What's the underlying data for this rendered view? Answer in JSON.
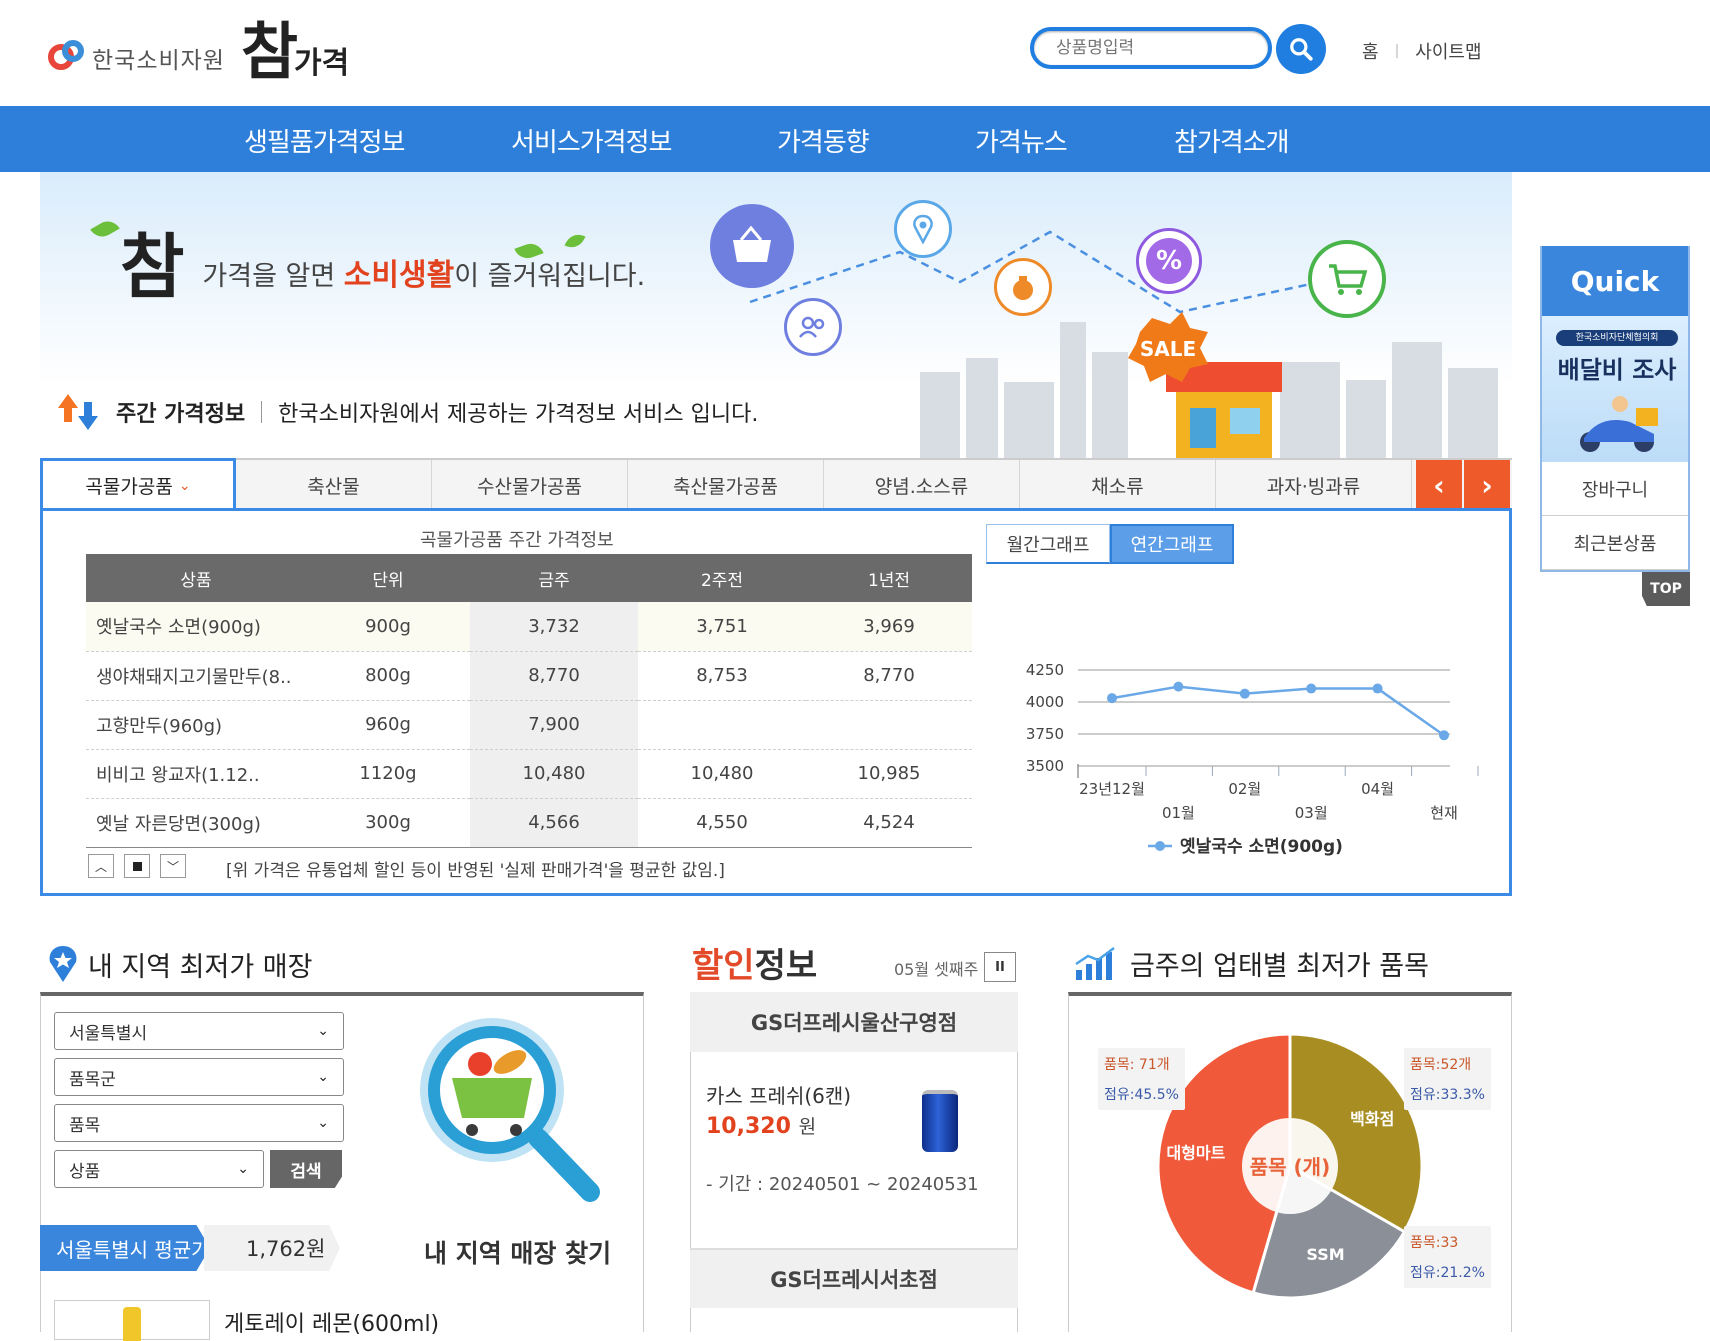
{
  "header": {
    "org_name": "한국소비자원",
    "brand": "참가격",
    "brand_big": "참",
    "brand_small": "가격",
    "search_placeholder": "상품명입력",
    "links": [
      "홈",
      "사이트맵"
    ]
  },
  "gnb": [
    "생필품가격정보",
    "서비스가격정보",
    "가격동향",
    "가격뉴스",
    "참가격소개"
  ],
  "banner": {
    "slogan_big": "참",
    "slogan_pre": "가격을 알면 ",
    "slogan_highlight": "소비생활",
    "slogan_post": "이 즐거워집니다.",
    "sale_badge": "SALE"
  },
  "weekly": {
    "title": "주간 가격정보",
    "desc": "한국소비자원에서 제공하는 가격정보 서비스 입니다.",
    "tabs": [
      "곡물가공품",
      "축산물",
      "수산물가공품",
      "축산물가공품",
      "양념.소스류",
      "채소류",
      "과자·빙과류"
    ],
    "active_tab": "곡물가공품",
    "table_caption": "곡물가공품 주간 가격정보",
    "columns": [
      "상품",
      "단위",
      "금주",
      "2주전",
      "1년전"
    ],
    "rows": [
      [
        "옛날국수 소면(900g)",
        "900g",
        "3,732",
        "3,751",
        "3,969"
      ],
      [
        "생야채돼지고기물만두(8..",
        "800g",
        "8,770",
        "8,753",
        "8,770"
      ],
      [
        "고향만두(960g)",
        "960g",
        "7,900",
        "",
        ""
      ],
      [
        "비비고 왕교자(1.12..",
        "1120g",
        "10,480",
        "10,480",
        "10,985"
      ],
      [
        "옛날 자른당면(300g)",
        "300g",
        "4,566",
        "4,550",
        "4,524"
      ]
    ],
    "note": "[위 가격은 유통업체 할인 등이 반영된 '실제 판매가격'을 평균한 값임.]",
    "graph_tabs": [
      "월간그래프",
      "연간그래프"
    ],
    "graph_active": "연간그래프"
  },
  "chart_data": {
    "type": "line",
    "x": [
      "23년12월",
      "01월",
      "02월",
      "03월",
      "04월",
      "현재"
    ],
    "series": [
      {
        "name": "옛날국수 소면(900g)",
        "values": [
          4030,
          4120,
          4065,
          4105,
          4105,
          3740
        ]
      }
    ],
    "yticks": [
      4250,
      4000,
      3750,
      3500
    ],
    "ylim": [
      3500,
      4250
    ],
    "grid": true,
    "legend": "bottom",
    "color": "#6aa8e8"
  },
  "quick": {
    "title": "Quick",
    "ad_line1": "한국소비자단체협의회",
    "ad_line2": "배달비 조사",
    "items": [
      "장바구니",
      "최근본상품"
    ],
    "top": "TOP"
  },
  "local": {
    "title": "내 지역 최저가 매장",
    "selects": [
      "서울특별시",
      "품목군",
      "품목",
      "상품"
    ],
    "search_btn": "검색",
    "avg_label": "서울특별시 평균가",
    "avg_value": "1,762원",
    "find_label": "내 지역 매장 찾기",
    "product": "게토레이 레몬(600ml)"
  },
  "discount": {
    "title_a": "할인",
    "title_b": "정보",
    "week": "05월 셋째주",
    "stores": [
      "GS더프레시울산구영점",
      "GS더프레시서초점"
    ],
    "product": "카스 프레쉬(6캔)",
    "price": "10,320",
    "price_unit": "원",
    "period": "- 기간 : 20240501 ~ 20240531"
  },
  "lowest": {
    "title": "금주의 업태별 최저가 품목",
    "center": "품목 (개)",
    "segments": [
      {
        "name": "대형마트",
        "count_label": "품목: 71개",
        "share_label": "점유:45.5%",
        "share": 45.5,
        "color": "#f05a3a"
      },
      {
        "name": "백화점",
        "count_label": "품목:52개",
        "share_label": "점유:33.3%",
        "share": 33.3,
        "color": "#a88e22"
      },
      {
        "name": "SSM",
        "count_label": "품목:33",
        "share_label": "점유:21.2%",
        "share": 21.2,
        "color": "#8b8f98"
      }
    ]
  }
}
